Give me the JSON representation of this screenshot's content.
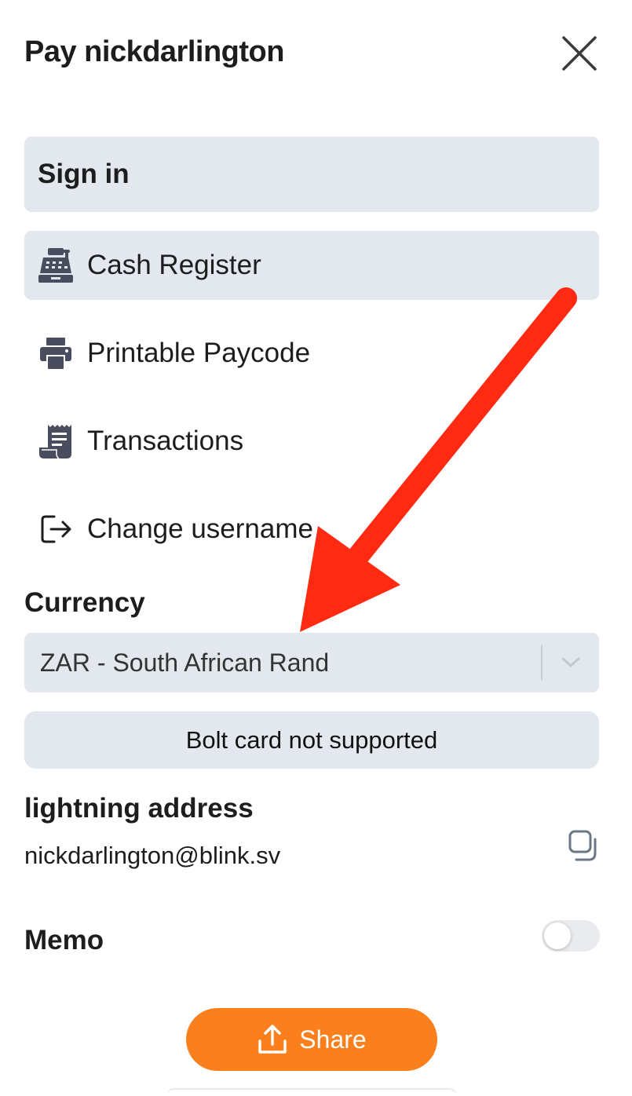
{
  "header": {
    "title": "Pay nickdarlington",
    "close_icon": "close-icon"
  },
  "menu": {
    "sign_in_label": "Sign in",
    "items": [
      {
        "label": "Cash Register",
        "icon": "cash-register-icon",
        "active": true
      },
      {
        "label": "Printable Paycode",
        "icon": "printer-icon",
        "active": false
      },
      {
        "label": "Transactions",
        "icon": "receipt-icon",
        "active": false
      },
      {
        "label": "Change username",
        "icon": "logout-icon",
        "active": false
      }
    ]
  },
  "currency": {
    "label": "Currency",
    "selected": "ZAR - South African Rand"
  },
  "bolt_card": {
    "label": "Bolt card not supported"
  },
  "lightning_address": {
    "label": "lightning address",
    "value": "nickdarlington@blink.sv"
  },
  "memo": {
    "label": "Memo",
    "enabled": false
  },
  "share": {
    "label": "Share",
    "icon": "share-icon"
  },
  "colors": {
    "accent": "#fa7f1d",
    "panel": "#e3e8ef",
    "annotation_arrow": "#ff2a12",
    "icon": "#4a4d5e"
  }
}
